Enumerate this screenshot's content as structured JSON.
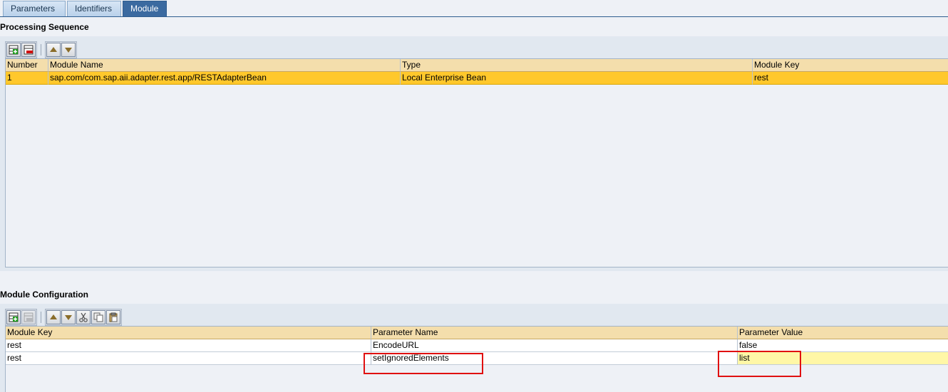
{
  "tabs": [
    {
      "label": "Parameters"
    },
    {
      "label": "Identifiers"
    },
    {
      "label": "Module"
    }
  ],
  "processing_sequence": {
    "title": "Processing Sequence",
    "columns": [
      "Number",
      "Module Name",
      "Type",
      "Module Key"
    ],
    "rows": [
      {
        "number": "1",
        "module_name": "sap.com/com.sap.aii.adapter.rest.app/RESTAdapterBean",
        "type": "Local Enterprise Bean",
        "module_key": "rest",
        "selected": true
      }
    ]
  },
  "module_configuration": {
    "title": "Module Configuration",
    "columns": [
      "Module Key",
      "Parameter Name",
      "Parameter Value"
    ],
    "rows": [
      {
        "module_key": "rest",
        "parameter_name": "EncodeURL",
        "parameter_value": "false"
      },
      {
        "module_key": "rest",
        "parameter_name": "setIgnoredElements",
        "parameter_value": "list"
      }
    ]
  },
  "icons": {
    "insert_row": "insert-row-icon",
    "delete_row": "delete-row-icon",
    "move_up": "arrow-up-icon",
    "move_down": "arrow-down-icon",
    "cut": "scissors-icon",
    "copy": "copy-icon",
    "paste": "paste-icon"
  },
  "colors": {
    "tab_active": "#3b6aa0",
    "header_bg": "#f4deac",
    "selected_row": "#ffc82c",
    "edit_cell": "#fff7a6",
    "highlight_box": "#e01010"
  }
}
